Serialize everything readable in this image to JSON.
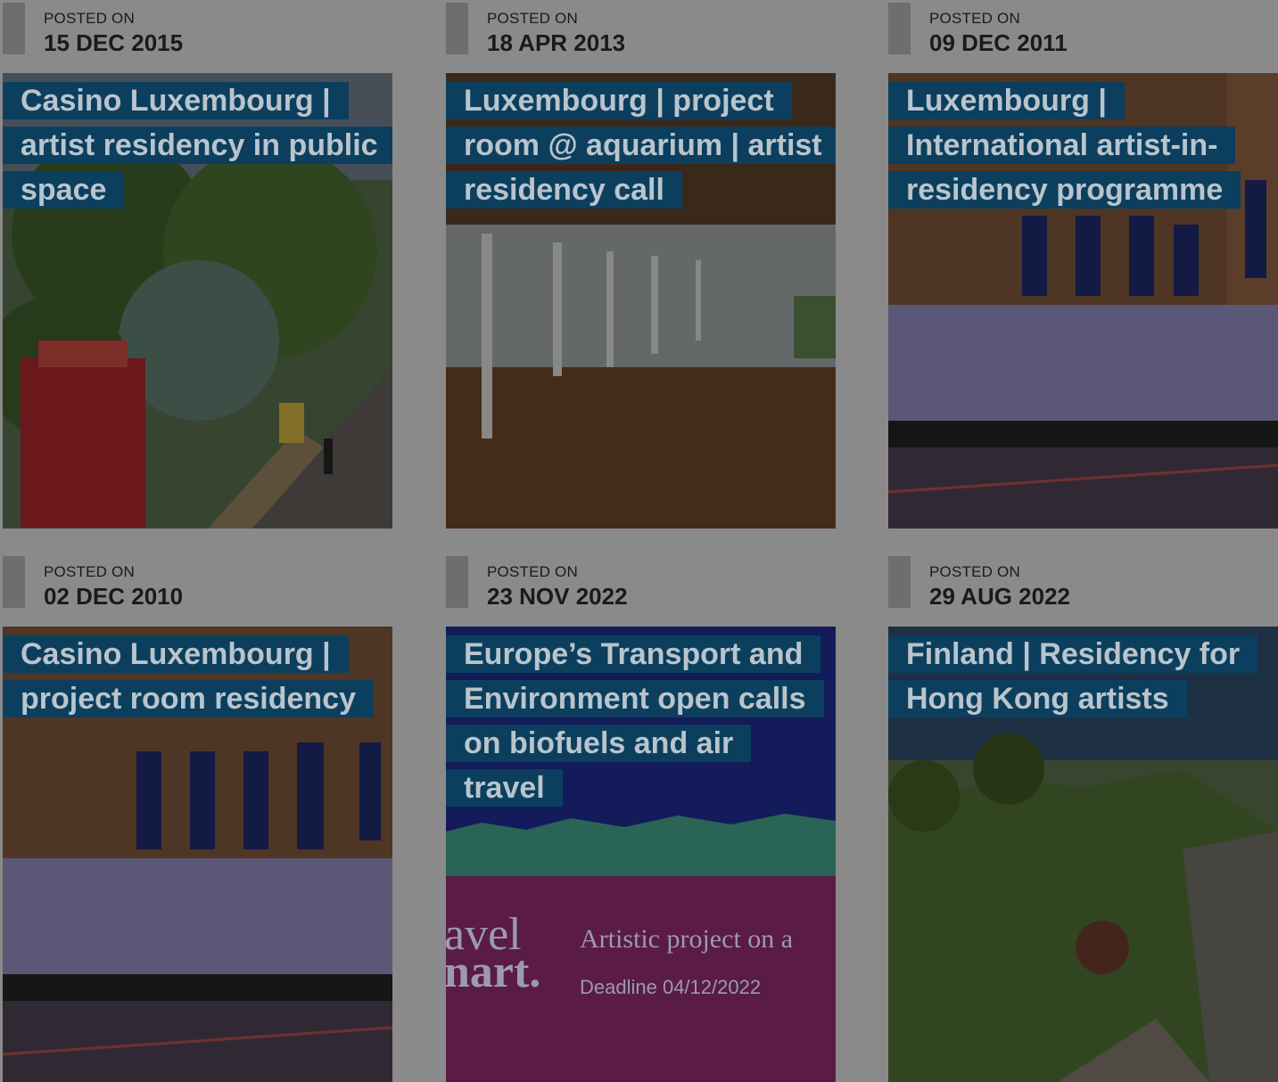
{
  "posted_label": "POSTED ON",
  "posts": [
    {
      "date": "15 DEC 2015",
      "title": "Casino Luxembourg | artist residency in public space",
      "image": "tree-aerial-photo"
    },
    {
      "date": "18 APR 2013",
      "title": "Luxembourg | project room @ aquarium | artist residency call",
      "image": "glass-room-photo"
    },
    {
      "date": "09 DEC 2011",
      "title": "Luxembourg | International artist-in-residency programme",
      "image": "building-photo"
    },
    {
      "date": "02 DEC 2010",
      "title": "Casino Luxembourg | project room residency",
      "image": "building-photo"
    },
    {
      "date": "23 NOV 2022",
      "title": "Europe’s Transport and Environment open calls on biofuels and air travel",
      "image": "poster-graphic",
      "poster": {
        "left_big": "avel",
        "left_big2": "nart.",
        "right_line": "Artistic project on a",
        "deadline": "Deadline 04/12/2022"
      }
    },
    {
      "date": "29 AUG 2022",
      "title": "Finland | Residency for Hong Kong artists",
      "image": "coast-photo"
    }
  ]
}
